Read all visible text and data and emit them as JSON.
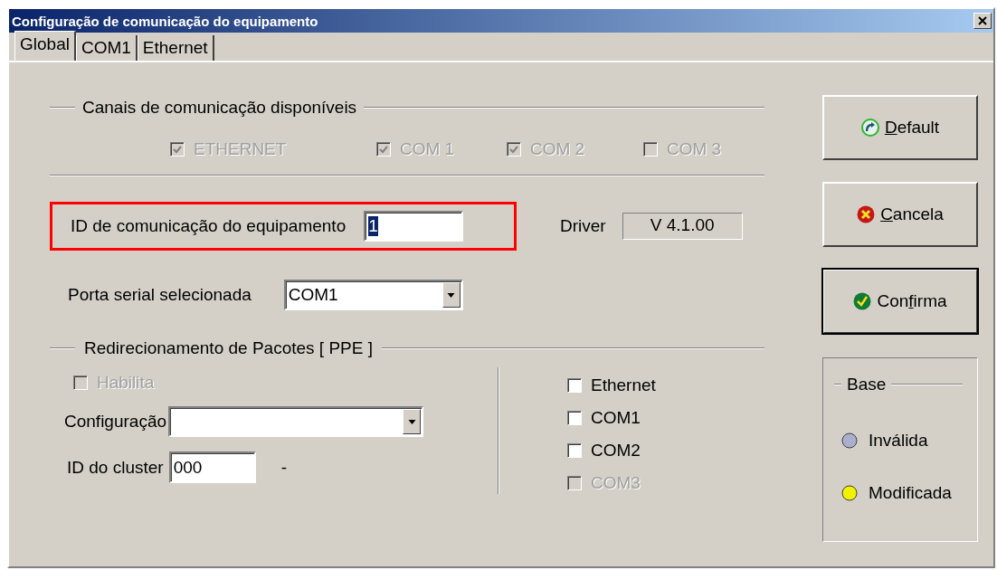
{
  "window": {
    "title": "Configuração de comunicação do equipamento"
  },
  "tabs": [
    {
      "label": "Global",
      "selected": true
    },
    {
      "label": "COM1",
      "selected": false
    },
    {
      "label": "Ethernet",
      "selected": false
    }
  ],
  "channels": {
    "title": "Canais de comunicação disponíveis",
    "items": [
      {
        "label": "ETHERNET",
        "checked": true,
        "disabled": true
      },
      {
        "label": "COM 1",
        "checked": true,
        "disabled": true
      },
      {
        "label": "COM 2",
        "checked": true,
        "disabled": true
      },
      {
        "label": "COM 3",
        "checked": false,
        "disabled": true
      }
    ]
  },
  "device_id": {
    "label": "ID de comunicação do equipamento",
    "value": "1",
    "highlighted": true,
    "text_selected": true
  },
  "driver": {
    "label": "Driver",
    "value": "V 4.1.00"
  },
  "serial_port": {
    "label": "Porta serial selecionada",
    "value": "COM1"
  },
  "redirect": {
    "title": "Redirecionamento de Pacotes [ PPE ]",
    "enable": {
      "label": "Habilita",
      "checked": false,
      "disabled": true
    },
    "config": {
      "label": "Configuração"
    },
    "cluster": {
      "label": "ID do cluster",
      "value": "000",
      "suffix": "-"
    },
    "interfaces": [
      {
        "label": "Ethernet",
        "checked": false,
        "disabled": false
      },
      {
        "label": "COM1",
        "checked": false,
        "disabled": false
      },
      {
        "label": "COM2",
        "checked": false,
        "disabled": false
      },
      {
        "label": "COM3",
        "checked": false,
        "disabled": true
      }
    ]
  },
  "buttons": [
    {
      "kind": "default",
      "mnemonic": "D",
      "label_end": "efault",
      "focused": false
    },
    {
      "kind": "cancel",
      "mnemonic": "C",
      "label_end": "ancela",
      "focused": false
    },
    {
      "kind": "confirm",
      "label_start": "Con",
      "mnemonic": "f",
      "label_end": "irma",
      "focused": true
    }
  ],
  "base": {
    "title": "Base",
    "items": [
      {
        "label": "Inválida",
        "color": "#aab0cc"
      },
      {
        "label": "Modificada",
        "color": "#f2f200"
      }
    ]
  }
}
